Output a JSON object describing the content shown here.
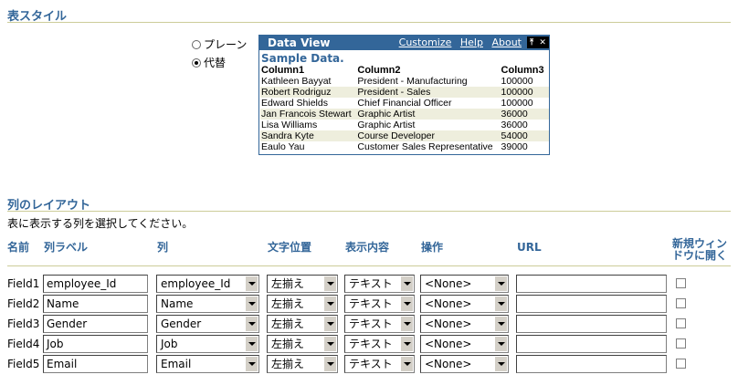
{
  "table_style": {
    "title": "表スタイル",
    "options": [
      {
        "label": "プレーン",
        "selected": false
      },
      {
        "label": "代替",
        "selected": true
      }
    ]
  },
  "data_view": {
    "title": "Data View",
    "links": [
      "Customize",
      "Help",
      "About"
    ],
    "subtitle": "Sample Data.",
    "columns": [
      "Column1",
      "Column2",
      "Column3"
    ],
    "rows": [
      [
        "Kathleen Bayyat",
        "President - Manufacturing",
        "100000"
      ],
      [
        "Robert Rodriguz",
        "President - Sales",
        "100000"
      ],
      [
        "Edward Shields",
        "Chief Financial Officer",
        "100000"
      ],
      [
        "Jan Francois Stewart",
        "Graphic Artist",
        "36000"
      ],
      [
        "Lisa Williams",
        "Graphic Artist",
        "36000"
      ],
      [
        "Sandra Kyte",
        "Course Developer",
        "54000"
      ],
      [
        "Eaulo Yau",
        "Customer Sales Representative",
        "39000"
      ]
    ]
  },
  "column_layout": {
    "title": "列のレイアウト",
    "description": "表に表示する列を選択してください。",
    "headers": {
      "name": "名前",
      "label": "列ラベル",
      "column": "列",
      "align": "文字位置",
      "display": "表示内容",
      "action": "操作",
      "url": "URL",
      "new_window_1": "新規ウィン",
      "new_window_2": "ドウに開く"
    },
    "rows": [
      {
        "name": "Field1",
        "label": "employee_Id",
        "column": "employee_Id",
        "align": "左揃え",
        "display": "テキスト",
        "action": "<None>",
        "url": "",
        "new_window": false
      },
      {
        "name": "Field2",
        "label": "Name",
        "column": "Name",
        "align": "左揃え",
        "display": "テキスト",
        "action": "<None>",
        "url": "",
        "new_window": false
      },
      {
        "name": "Field3",
        "label": "Gender",
        "column": "Gender",
        "align": "左揃え",
        "display": "テキスト",
        "action": "<None>",
        "url": "",
        "new_window": false
      },
      {
        "name": "Field4",
        "label": "Job",
        "column": "Job",
        "align": "左揃え",
        "display": "テキスト",
        "action": "<None>",
        "url": "",
        "new_window": false
      },
      {
        "name": "Field5",
        "label": "Email",
        "column": "Email",
        "align": "左揃え",
        "display": "テキスト",
        "action": "<None>",
        "url": "",
        "new_window": false
      }
    ]
  }
}
